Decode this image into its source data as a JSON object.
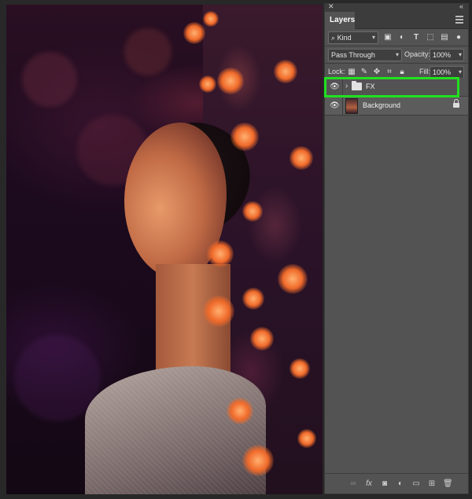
{
  "panel": {
    "title": "Layers",
    "filter": {
      "label": "Kind"
    },
    "blend_mode": "Pass Through",
    "opacity": {
      "label": "Opacity:",
      "value": "100%"
    },
    "lock": {
      "label": "Lock:"
    },
    "fill": {
      "label": "Fill:",
      "value": "100%"
    }
  },
  "layers": [
    {
      "name": "FX",
      "type": "group",
      "visible": true,
      "selected": true
    },
    {
      "name": "Background",
      "type": "image",
      "visible": true,
      "locked": true
    }
  ],
  "icons": {
    "close": "close-icon",
    "collapse": "collapse-icon",
    "menu": "panel-menu-icon",
    "search": "search-icon",
    "eye": "eye-icon",
    "folder": "folder-icon",
    "lock": "lock-icon"
  },
  "colors": {
    "panel_bg": "#535353",
    "highlight": "#20e020"
  }
}
